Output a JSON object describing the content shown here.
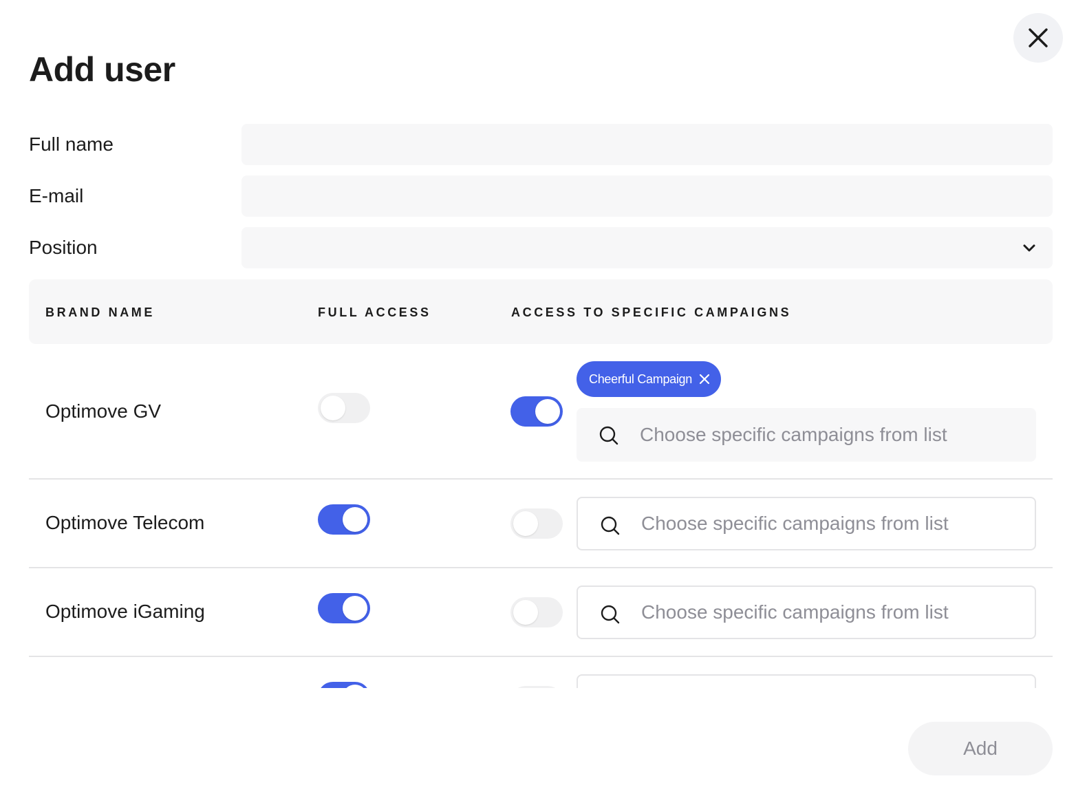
{
  "dialog": {
    "title": "Add user",
    "close_icon": "close-icon"
  },
  "form": {
    "full_name": {
      "label": "Full name",
      "value": "",
      "placeholder": ""
    },
    "email": {
      "label": "E-mail",
      "value": "",
      "placeholder": ""
    },
    "position": {
      "label": "Position",
      "value": "",
      "icon": "chevron-down-icon"
    }
  },
  "table": {
    "columns": [
      "BRAND NAME",
      "FULL ACCESS",
      "ACCESS TO SPECIFIC CAMPAIGNS"
    ],
    "rows": [
      {
        "brand": "Optimove GV",
        "full_access": false,
        "specific_access": true,
        "selected_campaigns": [
          "Cheerful Campaign"
        ],
        "search_placeholder": "Choose specific campaigns from list"
      },
      {
        "brand": "Optimove Telecom",
        "full_access": true,
        "specific_access": false,
        "selected_campaigns": [],
        "search_placeholder": "Choose specific campaigns from list"
      },
      {
        "brand": "Optimove iGaming",
        "full_access": true,
        "specific_access": false,
        "selected_campaigns": [],
        "search_placeholder": "Choose specific campaigns from list"
      },
      {
        "brand": "",
        "full_access": true,
        "specific_access": false,
        "selected_campaigns": [],
        "search_placeholder": ""
      }
    ]
  },
  "footer": {
    "add_label": "Add"
  },
  "colors": {
    "accent": "#4361e8",
    "toggle_off": "#f0f0f1",
    "field_bg": "#f7f7f8",
    "placeholder": "#8e8e96",
    "disabled_button_bg": "#f4f4f5",
    "divider": "#e4e4e6"
  }
}
